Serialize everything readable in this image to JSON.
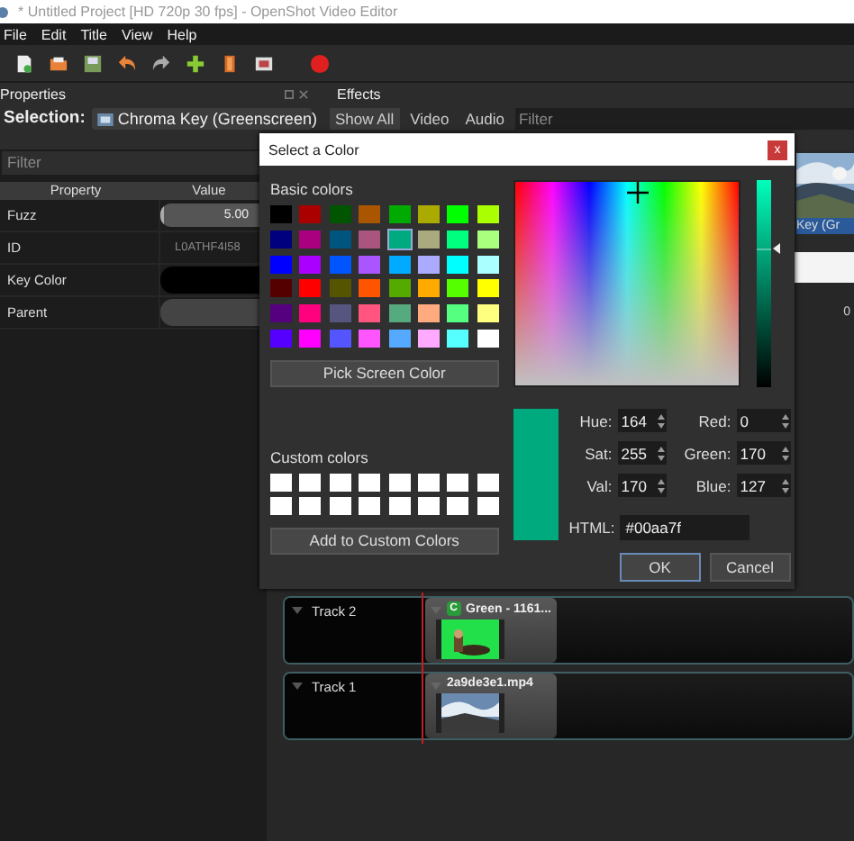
{
  "window": {
    "title": "* Untitled Project [HD 720p 30 fps] - OpenShot Video Editor"
  },
  "menu": [
    "File",
    "Edit",
    "Title",
    "View",
    "Help"
  ],
  "properties": {
    "title": "Properties",
    "selection_label": "Selection:",
    "selection": "Chroma Key (Greenscreen)",
    "filter_placeholder": "Filter",
    "columns": [
      "Property",
      "Value"
    ],
    "rows": [
      {
        "name": "Fuzz",
        "kind": "slider",
        "value": "5.00",
        "level": 0.03
      },
      {
        "name": "ID",
        "kind": "text",
        "value": "L0ATHF4I58"
      },
      {
        "name": "Key Color",
        "kind": "color",
        "color": "#000000"
      },
      {
        "name": "Parent",
        "kind": "dropdown"
      }
    ]
  },
  "effects": {
    "title": "Effects",
    "tabs": [
      {
        "label": "Show All",
        "selected": true
      },
      {
        "label": "Video",
        "selected": false
      },
      {
        "label": "Audio",
        "selected": false
      }
    ],
    "filter_placeholder": "Filter",
    "items": [
      {
        "label": "Key (Gr",
        "selected": true
      }
    ]
  },
  "timeline": {
    "ruler": "0",
    "tracks": [
      {
        "name": "Track 2",
        "clip": {
          "title": "Green - 1161...",
          "effect": "C"
        }
      },
      {
        "name": "Track 1",
        "clip": {
          "title": "2a9de3e1.mp4"
        }
      }
    ]
  },
  "dialog": {
    "title": "Select a Color",
    "close": "x",
    "basic_label": "Basic colors",
    "basic_colors": [
      {
        "color": "#000000",
        "selected": false
      },
      {
        "color": "#aa0000",
        "selected": false
      },
      {
        "color": "#005500",
        "selected": false
      },
      {
        "color": "#aa5500",
        "selected": false
      },
      {
        "color": "#00aa00",
        "selected": false
      },
      {
        "color": "#aaaa00",
        "selected": false
      },
      {
        "color": "#00ff00",
        "selected": false
      },
      {
        "color": "#aaff00",
        "selected": false
      },
      {
        "color": "#00007f",
        "selected": false
      },
      {
        "color": "#aa007f",
        "selected": false
      },
      {
        "color": "#00557f",
        "selected": false
      },
      {
        "color": "#aa557f",
        "selected": false
      },
      {
        "color": "#00aa7f",
        "selected": true
      },
      {
        "color": "#aaaa7f",
        "selected": false
      },
      {
        "color": "#00ff7f",
        "selected": false
      },
      {
        "color": "#aaff7f",
        "selected": false
      },
      {
        "color": "#0000ff",
        "selected": false
      },
      {
        "color": "#aa00ff",
        "selected": false
      },
      {
        "color": "#0055ff",
        "selected": false
      },
      {
        "color": "#aa55ff",
        "selected": false
      },
      {
        "color": "#00aaff",
        "selected": false
      },
      {
        "color": "#aaaaff",
        "selected": false
      },
      {
        "color": "#00ffff",
        "selected": false
      },
      {
        "color": "#aaffff",
        "selected": false
      },
      {
        "color": "#550000",
        "selected": false
      },
      {
        "color": "#ff0000",
        "selected": false
      },
      {
        "color": "#555500",
        "selected": false
      },
      {
        "color": "#ff5500",
        "selected": false
      },
      {
        "color": "#55aa00",
        "selected": false
      },
      {
        "color": "#ffaa00",
        "selected": false
      },
      {
        "color": "#55ff00",
        "selected": false
      },
      {
        "color": "#ffff00",
        "selected": false
      },
      {
        "color": "#55007f",
        "selected": false
      },
      {
        "color": "#ff007f",
        "selected": false
      },
      {
        "color": "#55557f",
        "selected": false
      },
      {
        "color": "#ff557f",
        "selected": false
      },
      {
        "color": "#55aa7f",
        "selected": false
      },
      {
        "color": "#ffaa7f",
        "selected": false
      },
      {
        "color": "#55ff7f",
        "selected": false
      },
      {
        "color": "#ffff7f",
        "selected": false
      },
      {
        "color": "#5500ff",
        "selected": false
      },
      {
        "color": "#ff00ff",
        "selected": false
      },
      {
        "color": "#5555ff",
        "selected": false
      },
      {
        "color": "#ff55ff",
        "selected": false
      },
      {
        "color": "#55aaff",
        "selected": false
      },
      {
        "color": "#ffaaff",
        "selected": false
      },
      {
        "color": "#55ffff",
        "selected": false
      },
      {
        "color": "#ffffff",
        "selected": false
      }
    ],
    "pick_button": "Pick Screen Color",
    "custom_label": "Custom colors",
    "custom_colors": [
      {
        "color": "#ffffff"
      },
      {
        "color": "#ffffff"
      },
      {
        "color": "#ffffff"
      },
      {
        "color": "#ffffff"
      },
      {
        "color": "#ffffff"
      },
      {
        "color": "#ffffff"
      },
      {
        "color": "#ffffff"
      },
      {
        "color": "#ffffff"
      },
      {
        "color": "#ffffff"
      },
      {
        "color": "#ffffff"
      },
      {
        "color": "#ffffff"
      },
      {
        "color": "#ffffff"
      },
      {
        "color": "#ffffff"
      },
      {
        "color": "#ffffff"
      },
      {
        "color": "#ffffff"
      },
      {
        "color": "#ffffff"
      }
    ],
    "add_button": "Add to Custom Colors",
    "value_slider": {
      "level": 0.667
    },
    "fields": [
      {
        "label": "Hue:",
        "value": "164"
      },
      {
        "label": "Red:",
        "value": "0"
      },
      {
        "label": "Sat:",
        "value": "255"
      },
      {
        "label": "Green:",
        "value": "170"
      },
      {
        "label": "Val:",
        "value": "170"
      },
      {
        "label": "Blue:",
        "value": "127"
      }
    ],
    "html_label": "HTML:",
    "html_value": "#00aa7f",
    "buttons": [
      {
        "label": "OK",
        "default": true
      },
      {
        "label": "Cancel",
        "default": false
      }
    ]
  }
}
